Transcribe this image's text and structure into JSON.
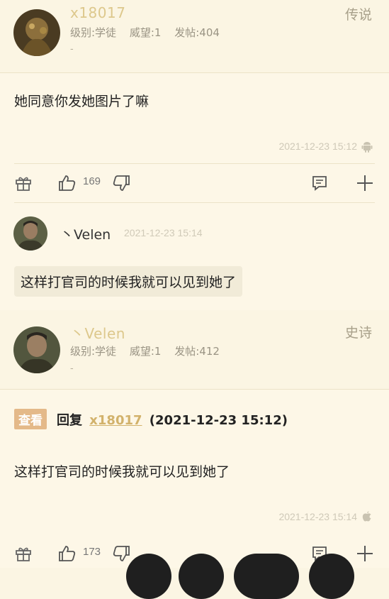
{
  "post1": {
    "username": "x18017",
    "rank": "传说",
    "level_label": "级别:学徒",
    "prestige_label": "威望:1",
    "posts_label": "发帖:404",
    "dash": "-",
    "content": "她同意你发她图片了嘛",
    "timestamp": "2021-12-23 15:12",
    "platform_icon": "android-icon",
    "likes": "169"
  },
  "reply1": {
    "name": "丶Velen",
    "time": "2021-12-23 15:14",
    "text": "这样打官司的时候我就可以见到她了"
  },
  "post2": {
    "username": "丶Velen",
    "rank": "史诗",
    "level_label": "级别:学徒",
    "prestige_label": "威望:1",
    "posts_label": "发帖:412",
    "dash": "-",
    "view_tag": "查看",
    "reply_word": "回复",
    "reply_to": "x18017",
    "reply_time": "(2021-12-23 15:12)",
    "content": "这样打官司的时候我就可以见到她了",
    "timestamp": "2021-12-23 15:14",
    "platform_icon": "apple-icon",
    "likes": "173"
  }
}
